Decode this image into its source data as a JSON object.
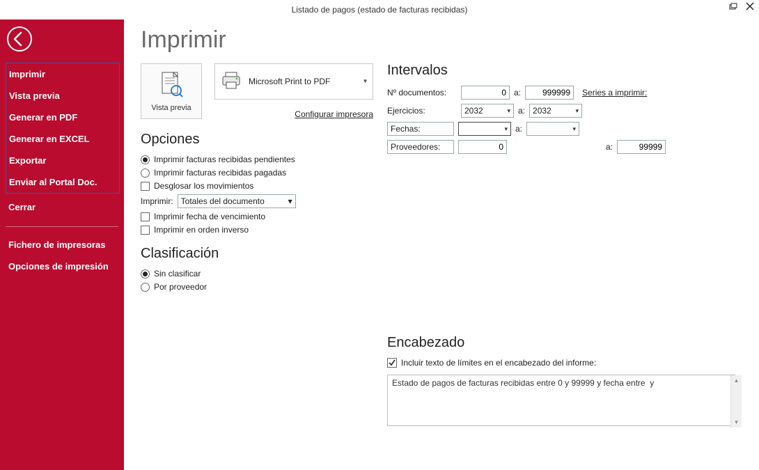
{
  "window": {
    "title": "Listado de pagos (estado de facturas recibidas)"
  },
  "sidebar": {
    "items": [
      "Imprimir",
      "Vista previa",
      "Generar en PDF",
      "Generar en EXCEL",
      "Exportar",
      "Enviar al Portal Doc."
    ],
    "close": "Cerrar",
    "extra": [
      "Fichero de impresoras",
      "Opciones de impresión"
    ]
  },
  "page": {
    "title": "Imprimir",
    "preview_label": "Vista previa",
    "printer_name": "Microsoft Print to PDF",
    "configure_printer": "Configurar impresora"
  },
  "opciones": {
    "heading": "Opciones",
    "r1": "Imprimir facturas recibidas pendientes",
    "r2": "Imprimir facturas recibidas pagadas",
    "c1": "Desglosar los movimientos",
    "print_label": "Imprimir:",
    "print_value": "Totales del documento",
    "c2": "Imprimir fecha de vencimiento",
    "c3": "Imprimir en orden inverso"
  },
  "clasificacion": {
    "heading": "Clasificación",
    "r1": "Sin clasificar",
    "r2": "Por proveedor"
  },
  "intervalos": {
    "heading": "Intervalos",
    "doc_label": "Nº documentos:",
    "doc_from": "0",
    "doc_to": "999999",
    "a": "a:",
    "series_link": "Series a imprimir:",
    "ejercicios_label": "Ejercicios:",
    "ejercicios_from": "2032",
    "ejercicios_to": "2032",
    "fechas_label": "Fechas:",
    "fechas_from": "",
    "fechas_to": "",
    "proveedores_label": "Proveedores:",
    "prov_from": "0",
    "prov_to": "99999"
  },
  "encabezado": {
    "heading": "Encabezado",
    "check_label": "Incluir texto de límites en el encabezado del informe:",
    "text": "Estado de pagos de facturas recibidas entre 0 y 99999 y fecha entre  y"
  }
}
